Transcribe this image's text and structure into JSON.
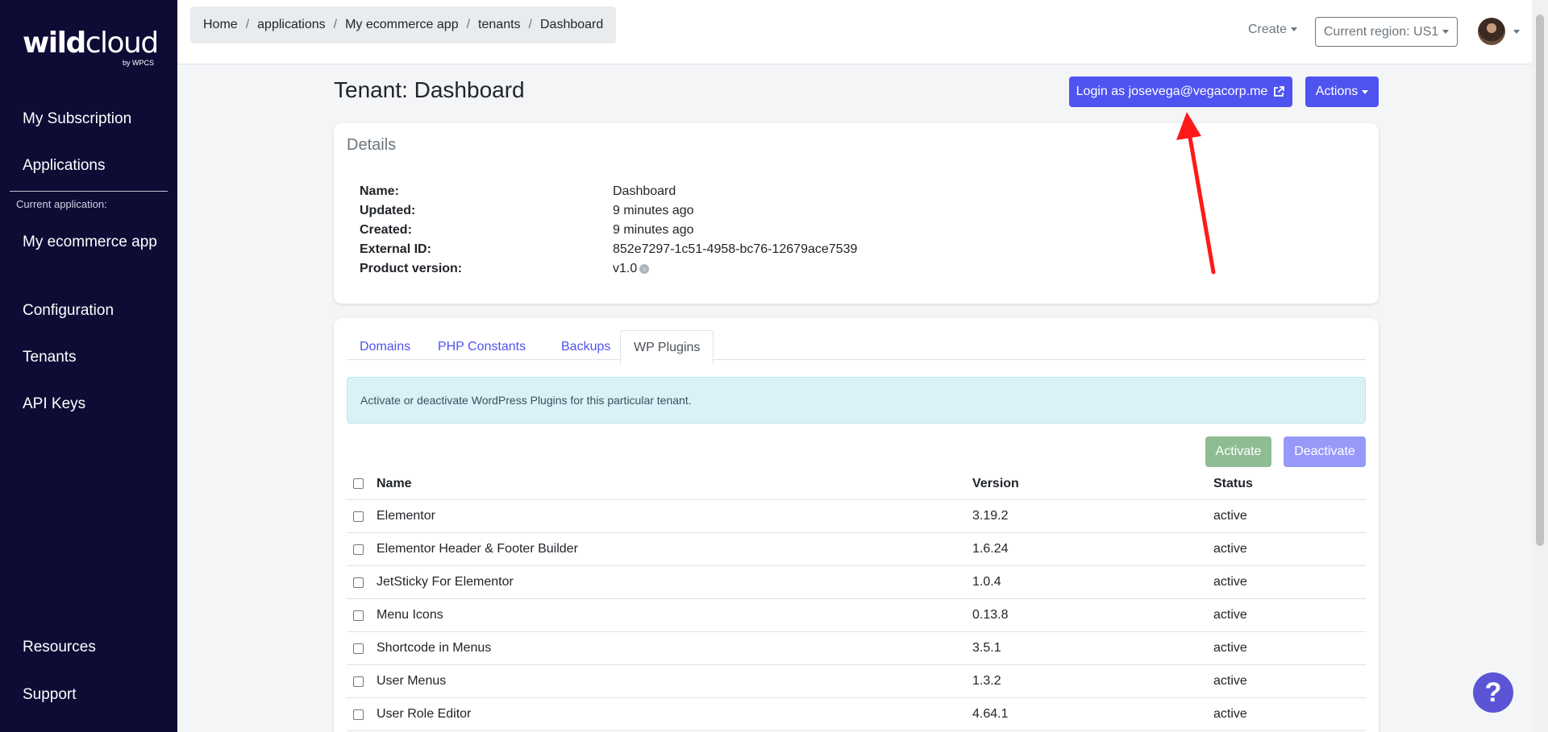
{
  "sidebar": {
    "logo": {
      "main_bold": "wild",
      "main_light": "cloud",
      "sub": "by WPCS"
    },
    "items": [
      {
        "label": "My Subscription"
      },
      {
        "label": "Applications"
      }
    ],
    "caption": "Current application:",
    "app_items": [
      {
        "label": "My ecommerce app"
      },
      {
        "label": "Configuration"
      },
      {
        "label": "Tenants"
      },
      {
        "label": "API Keys"
      }
    ],
    "bottom_items": [
      {
        "label": "Resources"
      },
      {
        "label": "Support"
      }
    ]
  },
  "topbar": {
    "breadcrumb": [
      "Home",
      "applications",
      "My ecommerce app",
      "tenants",
      "Dashboard"
    ],
    "create_label": "Create",
    "region_label": "Current region: US1"
  },
  "page": {
    "title": "Tenant: Dashboard",
    "login_button": "Login as josevega@vegacorp.me",
    "actions_button": "Actions"
  },
  "details": {
    "heading": "Details",
    "rows": [
      {
        "key": "Name:",
        "value": "Dashboard"
      },
      {
        "key": "Updated:",
        "value": "9 minutes ago"
      },
      {
        "key": "Created:",
        "value": "9 minutes ago"
      },
      {
        "key": "External ID:",
        "value": "852e7297-1c51-4958-bc76-12679ace7539"
      },
      {
        "key": "Product version:",
        "value": "v1.0"
      }
    ]
  },
  "tabs": [
    {
      "label": "Domains"
    },
    {
      "label": "PHP Constants"
    },
    {
      "label": "Backups"
    },
    {
      "label": "WP Plugins"
    }
  ],
  "plugins": {
    "info": "Activate or deactivate WordPress Plugins for this particular tenant.",
    "activate_label": "Activate",
    "deactivate_label": "Deactivate",
    "columns": {
      "name": "Name",
      "version": "Version",
      "status": "Status"
    },
    "rows": [
      {
        "name": "Elementor",
        "version": "3.19.2",
        "status": "active"
      },
      {
        "name": "Elementor Header & Footer Builder",
        "version": "1.6.24",
        "status": "active"
      },
      {
        "name": "JetSticky For Elementor",
        "version": "1.0.4",
        "status": "active"
      },
      {
        "name": "Menu Icons",
        "version": "0.13.8",
        "status": "active"
      },
      {
        "name": "Shortcode in Menus",
        "version": "3.5.1",
        "status": "active"
      },
      {
        "name": "User Menus",
        "version": "1.3.2",
        "status": "active"
      },
      {
        "name": "User Role Editor",
        "version": "4.64.1",
        "status": "active"
      }
    ]
  },
  "help": {
    "symbol": "?"
  },
  "colors": {
    "sidebar_bg": "#0e0c35",
    "primary": "#4f53f0",
    "activate": "#8fbc92",
    "deactivate": "#9799f9",
    "annotation": "#ff1a1a"
  }
}
